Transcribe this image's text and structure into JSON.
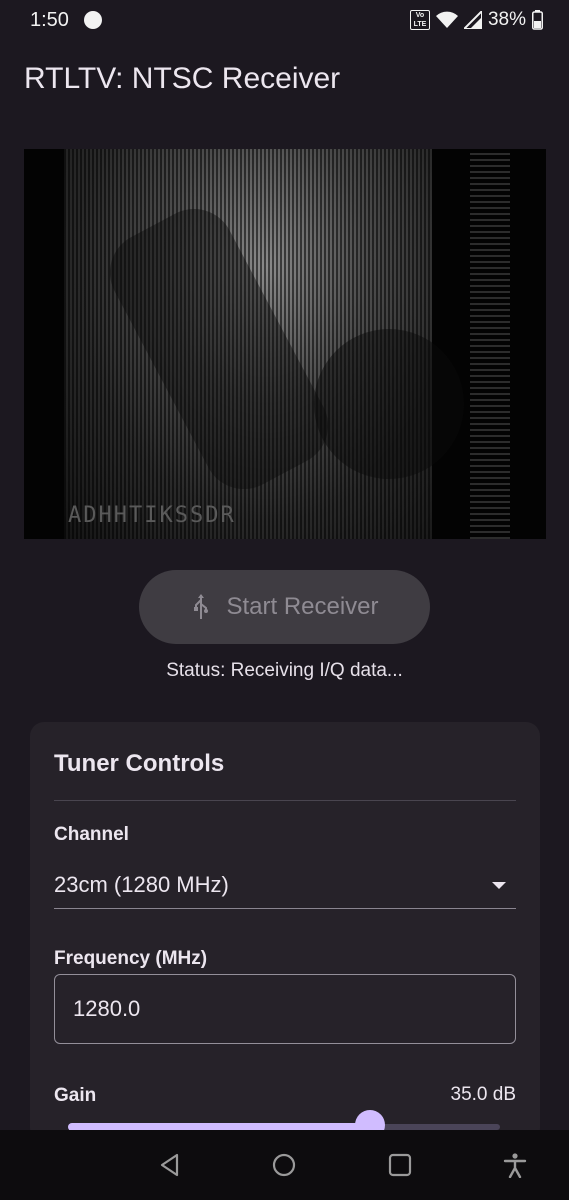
{
  "status_bar": {
    "time": "1:50",
    "network_badge": "VoLTE",
    "battery": "38%"
  },
  "app": {
    "title": "RTLTV: NTSC Receiver"
  },
  "video": {
    "overlay_text": "ADHHTIKSSDR"
  },
  "start_button": {
    "label": "Start Receiver",
    "icon": "usb-icon",
    "enabled": false
  },
  "status": {
    "text": "Status: Receiving I/Q data..."
  },
  "tuner": {
    "title": "Tuner Controls",
    "channel_label": "Channel",
    "channel_value": "23cm (1280 MHz)",
    "frequency_label": "Frequency (MHz)",
    "frequency_value": "1280.0",
    "gain_label": "Gain",
    "gain_value": "35.0 dB",
    "gain_fraction": 0.7
  },
  "nav": {
    "back_icon": "back-icon",
    "home_icon": "home-icon",
    "recents_icon": "recents-icon",
    "accessibility_icon": "accessibility-icon"
  },
  "colors": {
    "background": "#1c1820",
    "card": "#262229",
    "accent": "#d0bcff",
    "button_disabled": "#3f3c42"
  }
}
